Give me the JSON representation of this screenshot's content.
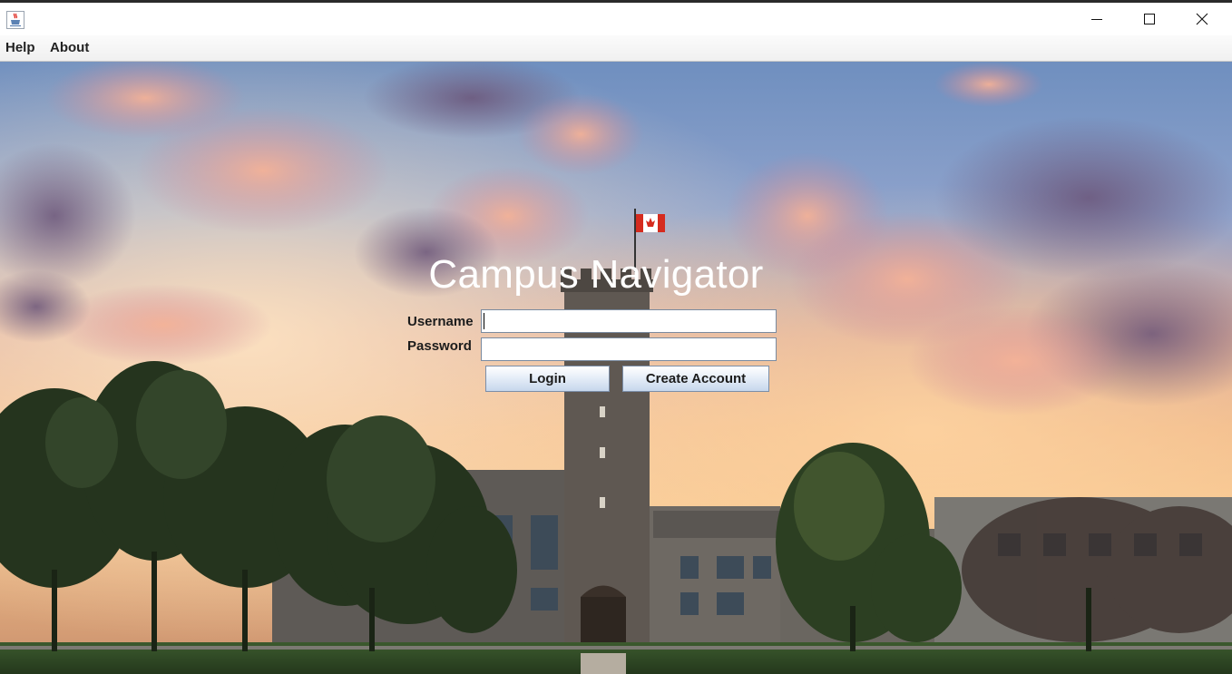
{
  "window": {
    "icon": "java-cup-icon",
    "controls": {
      "minimize": "minimize-icon",
      "maximize": "maximize-icon",
      "close": "close-icon"
    }
  },
  "menu": {
    "items": [
      {
        "label": "Help"
      },
      {
        "label": "About"
      }
    ]
  },
  "login": {
    "title": "Campus Navigator",
    "username_label": "Username",
    "username_value": "",
    "password_label": "Password",
    "password_value": "",
    "login_button": "Login",
    "create_account_button": "Create Account"
  },
  "colors": {
    "accent_button_top": "#ffffff",
    "accent_button_bottom": "#c7d7ec",
    "title_text": "#ffffff"
  }
}
